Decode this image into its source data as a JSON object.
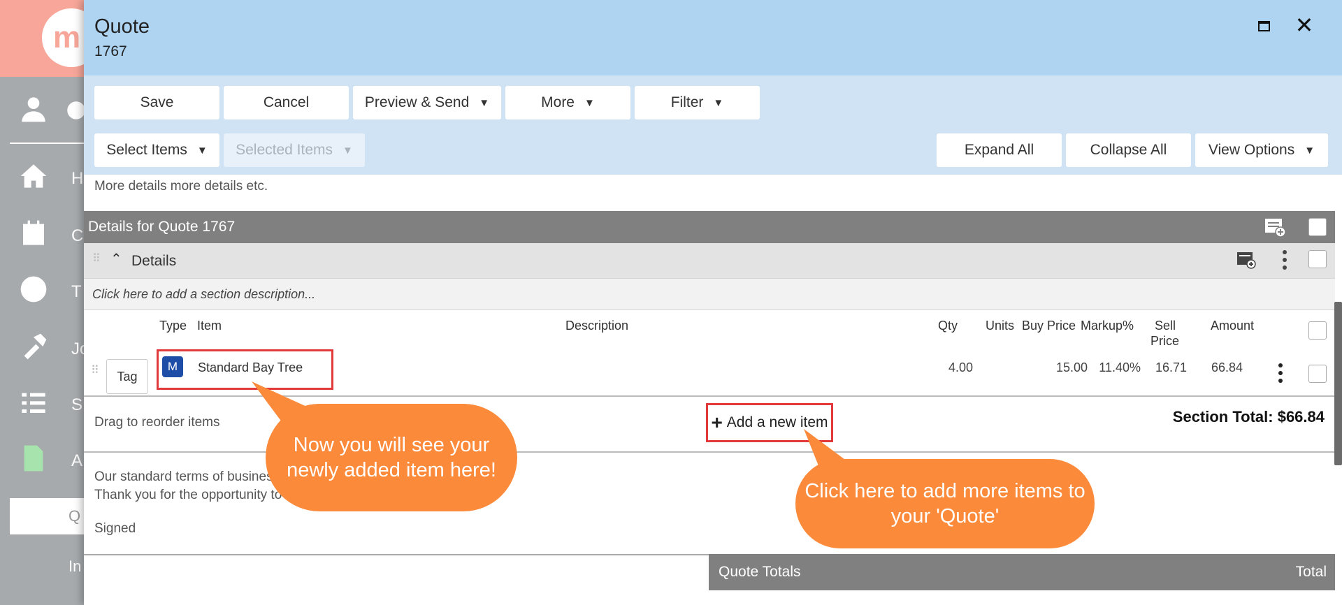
{
  "background": {
    "logo_text": "m",
    "nav_letters": [
      "H",
      "C",
      "T",
      "Jo",
      "S",
      "A"
    ],
    "active_tab_letter": "Q",
    "bottom_letter": "In"
  },
  "header": {
    "title": "Quote",
    "subtitle": "1767"
  },
  "toolbar": {
    "save": "Save",
    "cancel": "Cancel",
    "preview_send": "Preview & Send",
    "more": "More",
    "filter": "Filter",
    "select_items": "Select Items",
    "selected_items": "Selected Items",
    "expand_all": "Expand All",
    "collapse_all": "Collapse All",
    "view_options": "View Options"
  },
  "content": {
    "more_details": "More details more details etc.",
    "details_header": "Details for Quote 1767",
    "section_name": "Details",
    "section_description_placeholder": "Click here to add a section description...",
    "columns": {
      "type": "Type",
      "item": "Item",
      "description": "Description",
      "qty": "Qty",
      "units": "Units",
      "buy_price": "Buy Price",
      "markup": "Markup%",
      "sell_price_1": "Sell",
      "sell_price_2": "Price",
      "amount": "Amount"
    },
    "item": {
      "tag": "Tag",
      "type_badge": "M",
      "name": "Standard Bay Tree",
      "qty": "4.00",
      "buy_price": "15.00",
      "markup": "11.40%",
      "sell_price": "16.71",
      "amount": "66.84"
    },
    "drag_reorder": "Drag to reorder items",
    "add_new_item": "Add a new item",
    "section_total": "Section Total: $66.84",
    "terms_line1": "Our standard terms of business",
    "terms_line2": "Thank you for the opportunity to",
    "signed": "Signed",
    "totals_title": "Quote Totals",
    "totals_col": "Total"
  },
  "callouts": {
    "bubble1": "Now you will see your newly added item here!",
    "bubble2": "Click here to add more items to your 'Quote'"
  },
  "colors": {
    "header_bg": "#aed4f2",
    "toolbar_bg": "#cfe3f5",
    "callout": "#fc8a3b",
    "highlight": "#e23a3a",
    "type_badge": "#1e4da8"
  }
}
